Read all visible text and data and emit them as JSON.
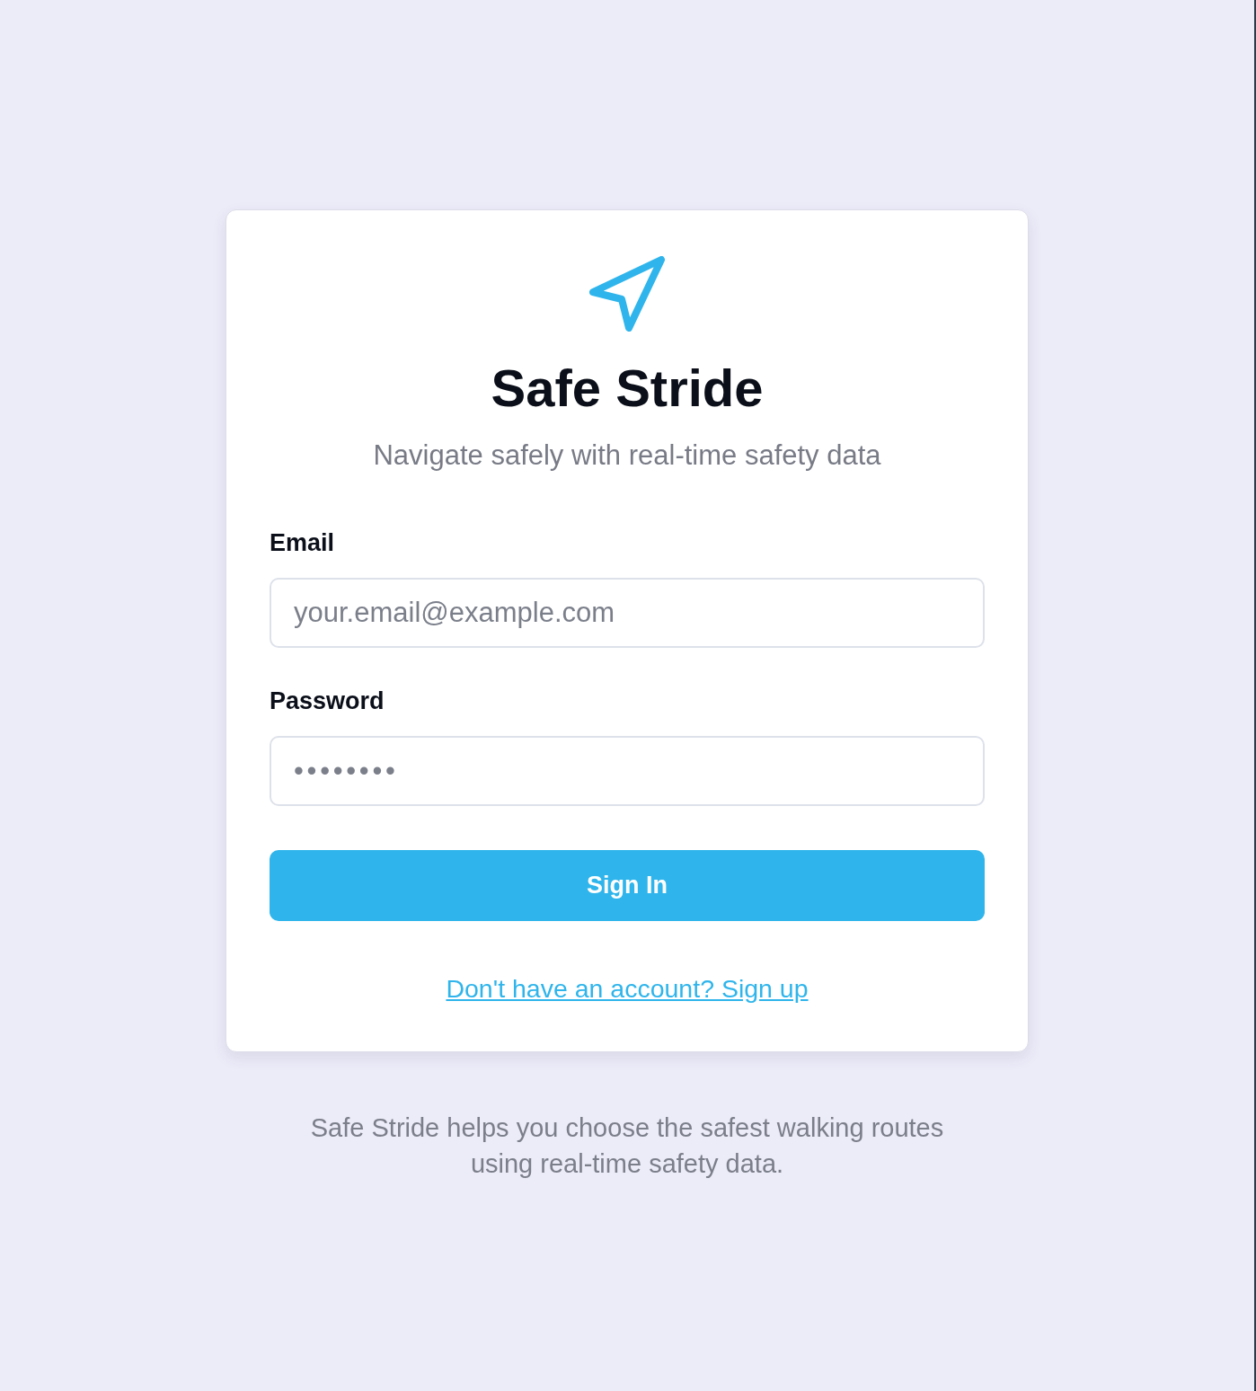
{
  "header": {
    "title": "Safe Stride",
    "subtitle": "Navigate safely with real-time safety data"
  },
  "form": {
    "fields": [
      {
        "kind": "email",
        "label": "Email",
        "placeholder": "your.email@example.com"
      },
      {
        "kind": "password",
        "label": "Password",
        "placeholder": "••••••••"
      }
    ],
    "submit_button": "Sign In",
    "signup_link": "Don't have an account? Sign up"
  },
  "footer": "Safe Stride helps you choose the safest walking routes using real-time safety data."
}
